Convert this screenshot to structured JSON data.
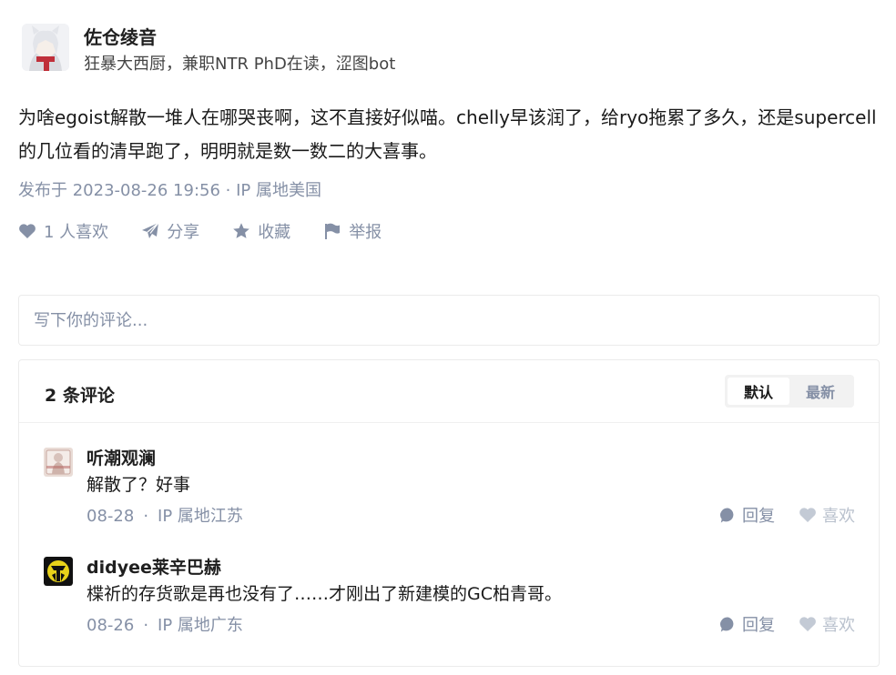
{
  "author": {
    "name": "佐仓绫音",
    "bio": "狂暴大西厨，兼职NTR PhD在读，涩图bot"
  },
  "post": {
    "content": "为啥egoist解散一堆人在哪哭丧啊，这不直接好似喵。chelly早该润了，给ryo拖累了多久，还是supercell的几位看的清早跑了，明明就是数一数二的大喜事。",
    "meta": "发布于 2023-08-26 19:56 · IP 属地美国"
  },
  "actions": {
    "like": "1 人喜欢",
    "share": "分享",
    "favorite": "收藏",
    "report": "举报"
  },
  "comment_input": {
    "placeholder": "写下你的评论..."
  },
  "comments": {
    "count_label": "2 条评论",
    "sort_default": "默认",
    "sort_latest": "最新",
    "items": [
      {
        "name": "听潮观澜",
        "text": "解散了？好事",
        "date": "08-28",
        "ip": "IP 属地江苏",
        "reply": "回复",
        "like": "喜欢"
      },
      {
        "name": "didyee莱辛巴赫",
        "text": "楪祈的存货歌是再也没有了……才刚出了新建模的GC柏青哥。",
        "date": "08-26",
        "ip": "IP 属地广东",
        "reply": "回复",
        "like": "喜欢"
      }
    ]
  },
  "colors": {
    "meta_gray": "#8590a6",
    "like_light": "#b9c1cd",
    "border": "#ebebeb"
  }
}
